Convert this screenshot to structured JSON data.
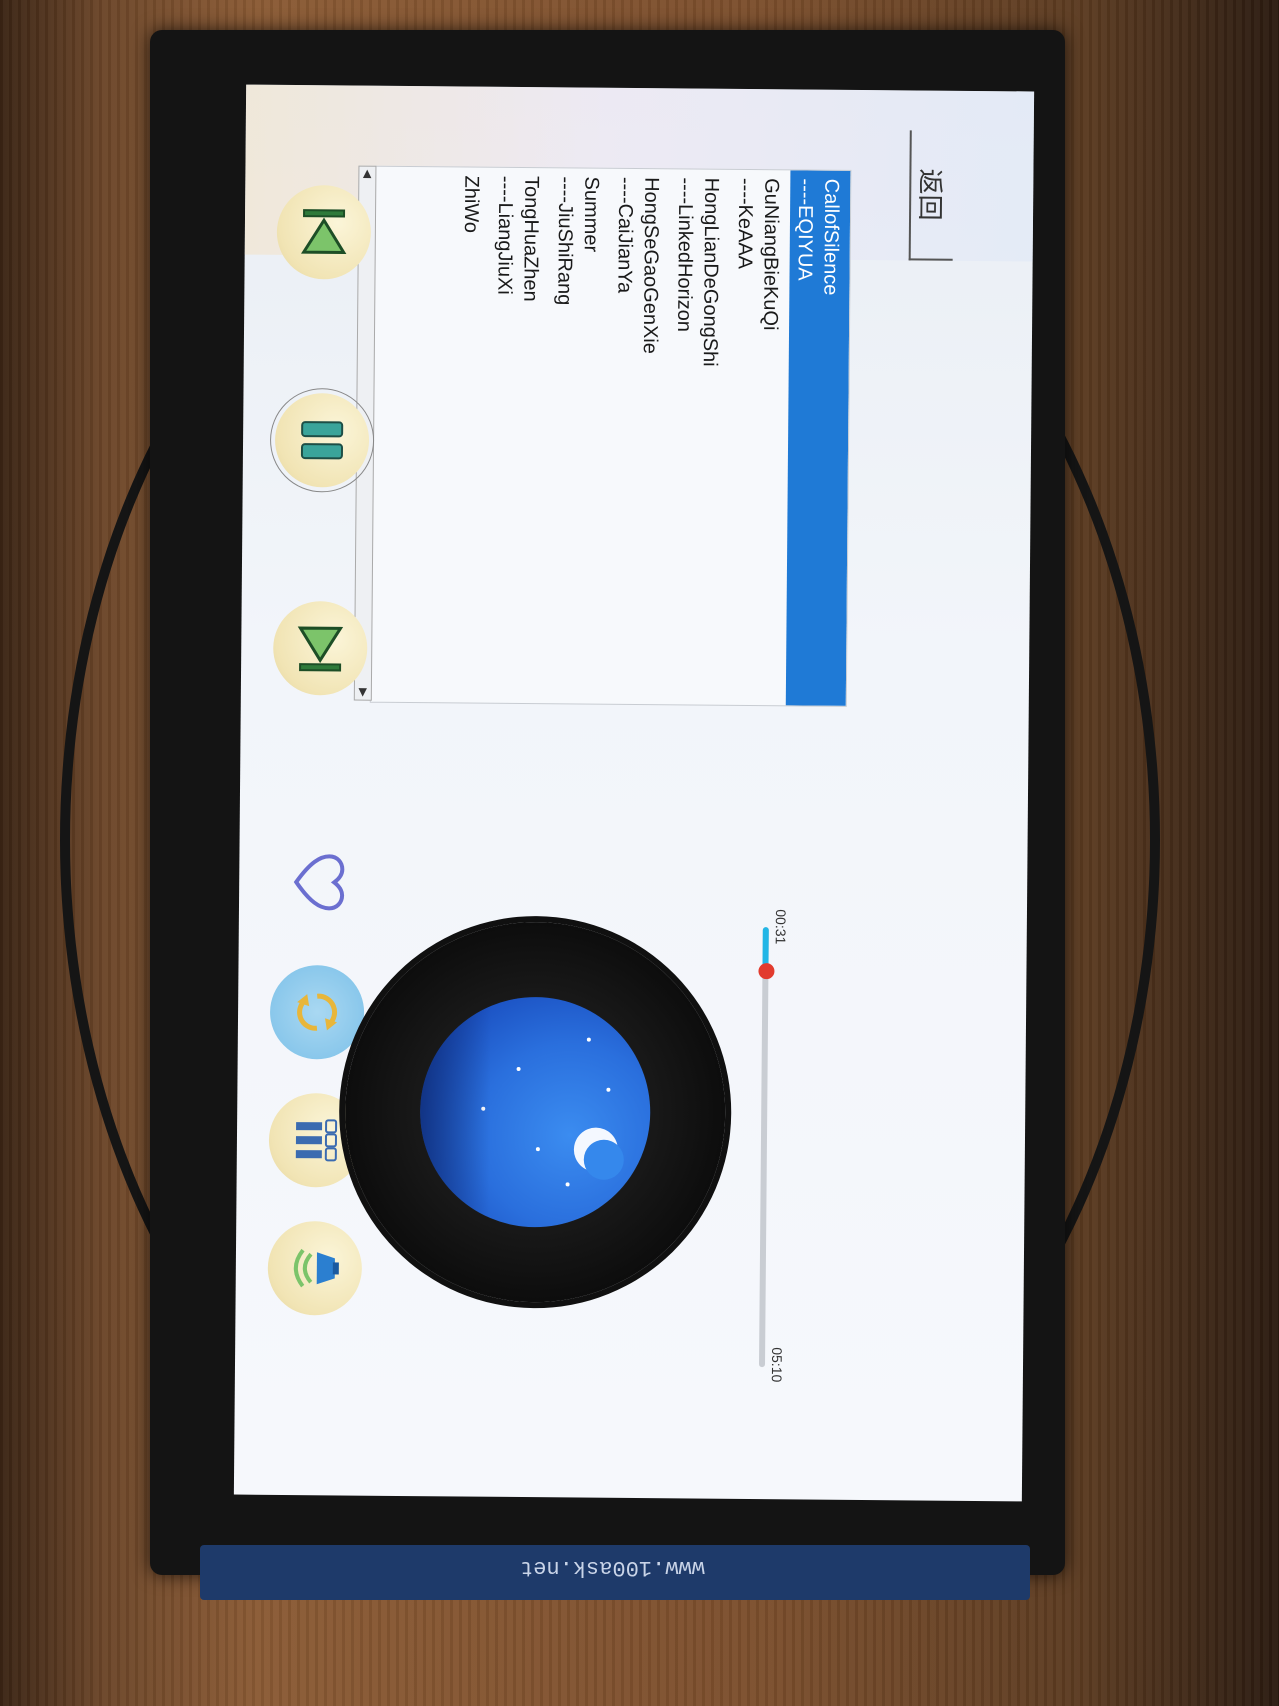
{
  "header": {
    "back_label": "返回"
  },
  "playlist": {
    "items": [
      {
        "title": "CallofSilence",
        "artist": "----EQIYUA"
      },
      {
        "title": "GuNiangBieKuQi",
        "artist": "----KeAAA"
      },
      {
        "title": "HongLianDeGongShi",
        "artist": "----LinkedHorizon"
      },
      {
        "title": "HongSeGaoGenXie",
        "artist": "----CaiJianYa"
      },
      {
        "title": "Summer",
        "artist": "----JiuShiRang"
      },
      {
        "title": "TongHuaZhen",
        "artist": "----LiangJiuXi"
      },
      {
        "title": "ZhiWo",
        "artist": ""
      }
    ],
    "selected_index": 0
  },
  "player": {
    "current_time": "00:31",
    "total_time": "05:10",
    "progress_fraction": 0.1
  },
  "controls": {
    "prev_icon": "previous-track-icon",
    "pause_icon": "pause-icon",
    "next_icon": "next-track-icon",
    "favorite_icon": "heart-icon",
    "repeat_icon": "repeat-icon",
    "playlist_icon": "playlist-icon",
    "volume_icon": "speaker-icon"
  },
  "colors": {
    "selection": "#1f7ad6",
    "progress": "#22b6e6",
    "knob": "#e23b2e",
    "control_bg": "#f1e4b4"
  },
  "board": {
    "silkscreen": "www.100ask.net"
  }
}
